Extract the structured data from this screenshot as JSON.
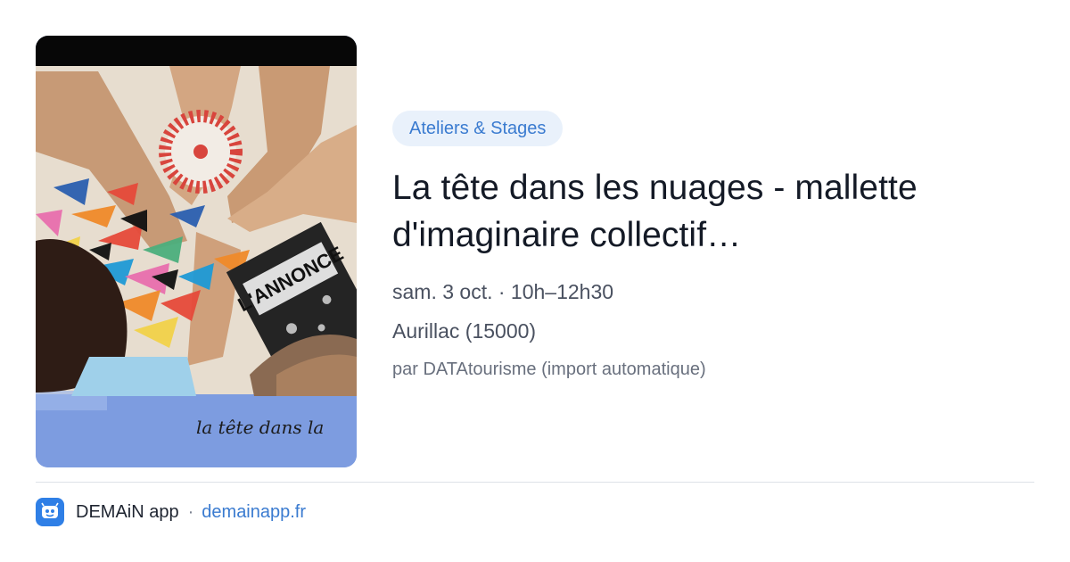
{
  "event": {
    "category": "Ateliers & Stages",
    "title": "La tête dans les nuages - mallette d'imaginaire collectif…",
    "datetime": "sam. 3 oct. · 10h–12h30",
    "location": "Aurillac (15000)",
    "source": "par DATAtourisme (import automatique)",
    "image": {
      "caption_text": "la tête dans la",
      "booklet_text": "L'ANNONCE"
    }
  },
  "footer": {
    "app_name": "DEMAiN app",
    "separator": "·",
    "site": "demainapp.fr",
    "app_icon": "demain-app-icon"
  },
  "colors": {
    "accent": "#3a7bd0",
    "badge_bg": "#e9f1fb",
    "title": "#141a26",
    "image_band": "#7d9ce0"
  }
}
